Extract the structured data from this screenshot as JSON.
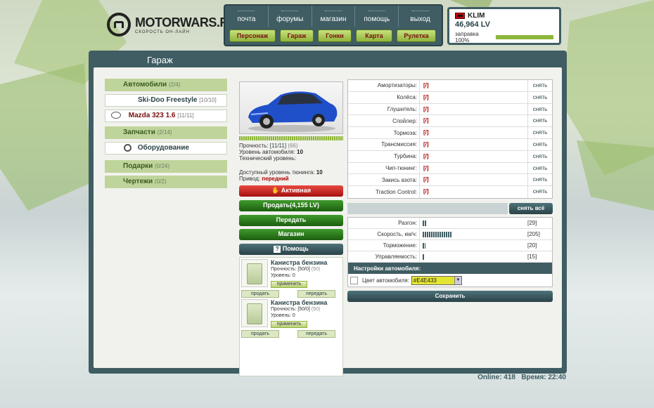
{
  "logo": {
    "title": "MOTORWARS.RU",
    "subtitle": "СКОРОСТЬ ОН-ЛАЙН"
  },
  "topnav": {
    "links": [
      "почта",
      "форумы",
      "магазин",
      "помощь",
      "выход"
    ],
    "buttons": [
      "Персонаж",
      "Гараж",
      "Гонки",
      "Карта",
      "Рулетка"
    ]
  },
  "user": {
    "name": "KLIM",
    "money": "46,964 LV",
    "fuel_label": "заправка 100%",
    "fuel_percent": 100
  },
  "page": {
    "title": "Гараж"
  },
  "sidebar": {
    "cats": [
      {
        "label": "Автомобили",
        "count": "(2/4)"
      },
      {
        "label": "Запчасти",
        "count": "(2/14)"
      },
      {
        "label": "Подарки",
        "count": "(0/24)"
      },
      {
        "label": "Чертежи",
        "count": "(0/2)"
      }
    ],
    "cars": [
      {
        "label": "Ski-Doo Freestyle",
        "count": "[10/10]"
      },
      {
        "label": "Mazda 323 1.6",
        "count": "[11/11]"
      }
    ],
    "equipment": "Оборудование"
  },
  "car": {
    "durability_label": "Прочность:",
    "durability_value": "[11/11]",
    "durability_extra": "(66)",
    "level_label": "Уровень автомобиля:",
    "level_value": "10",
    "tech_label": "Технический уровень:",
    "tuning_label": "Доступный уровень тюнинга:",
    "tuning_value": "10",
    "drive_label": "Привод:",
    "drive_value": "передний"
  },
  "actions": {
    "active": "Активная",
    "sell": "Продать(4,155 LV)",
    "transfer": "Передать",
    "shop": "Магазин",
    "help": "Помощь"
  },
  "items": [
    {
      "name": "Канистра бензина",
      "durability_label": "Прочность:",
      "durability": "[50/0]",
      "extra": "(50)",
      "level_label": "Уровень:",
      "level": "0",
      "apply": "применить",
      "sell": "продать",
      "transfer": "передать"
    },
    {
      "name": "Канистра бензина",
      "durability_label": "Прочность:",
      "durability": "[50/0]",
      "extra": "(50)",
      "level_label": "Уровень:",
      "level": "0",
      "apply": "применить",
      "sell": "продать",
      "transfer": "передать"
    }
  ],
  "parts": [
    {
      "label": "Амортизаторы:",
      "value": "[/]",
      "action": "снять"
    },
    {
      "label": "Колёса:",
      "value": "[/]",
      "action": "снять"
    },
    {
      "label": "Глушитель:",
      "value": "[/]",
      "action": "снять"
    },
    {
      "label": "Спойлер:",
      "value": "[/]",
      "action": "снять"
    },
    {
      "label": "Тормоза:",
      "value": "[/]",
      "action": "снять"
    },
    {
      "label": "Трансмиссия:",
      "value": "[/]",
      "action": "снять"
    },
    {
      "label": "Турбина:",
      "value": "[/]",
      "action": "снять"
    },
    {
      "label": "Чип-тюнинг:",
      "value": "[/]",
      "action": "снять"
    },
    {
      "label": "Закись азота:",
      "value": "[/]",
      "action": "снять"
    },
    {
      "label": "Traction Control:",
      "value": "[/]",
      "action": "снять"
    }
  ],
  "remove_all": "снять всё",
  "stats": [
    {
      "label": "Разгон:",
      "value": 29,
      "text": "[29]"
    },
    {
      "label": "Скорость, км/ч:",
      "value": 205,
      "text": "[205]"
    },
    {
      "label": "Торможение:",
      "value": 20,
      "text": "[20]"
    },
    {
      "label": "Управляемость:",
      "value": 15,
      "text": "[15]"
    }
  ],
  "settings": {
    "title": "Настройки автомобиля:",
    "color_label": "Цвет автомобиля:",
    "color_value": "#E4E433",
    "save": "Сохранить"
  },
  "footer": {
    "online": "Online: 418",
    "time": "Время: 22:40"
  },
  "colors": {
    "accent": "#3f5d63",
    "green": "#8eb63a",
    "brand_red": "#a00000"
  }
}
